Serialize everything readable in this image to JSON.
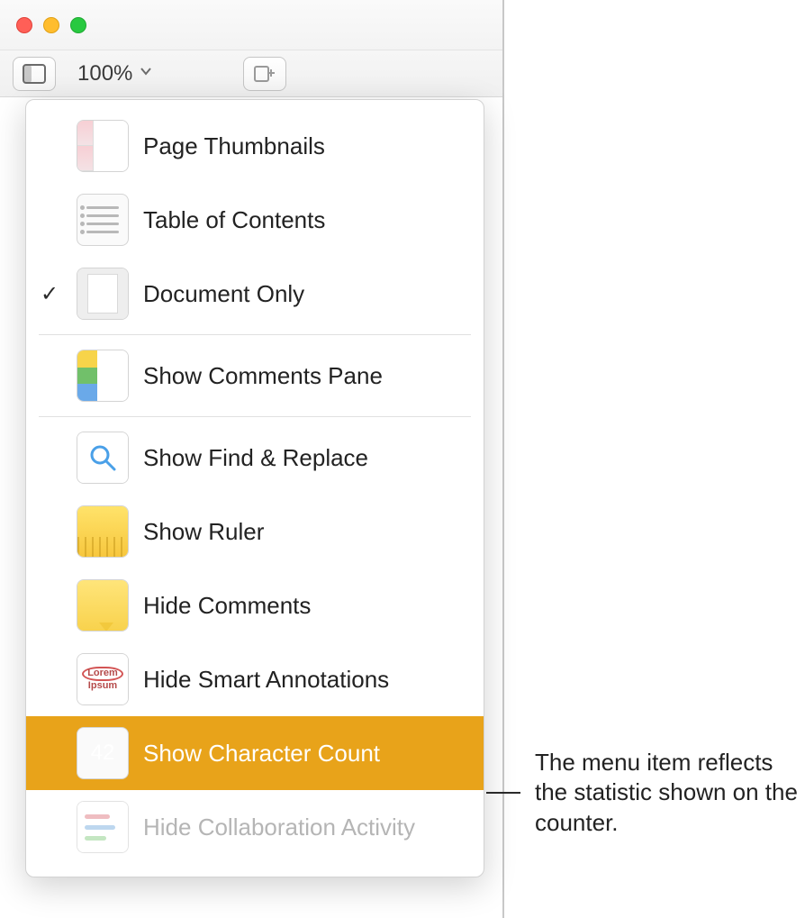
{
  "toolbar": {
    "zoom_label": "100%"
  },
  "menu": {
    "items": {
      "page_thumbnails": "Page Thumbnails",
      "table_of_contents": "Table of Contents",
      "document_only": "Document Only",
      "show_comments_pane": "Show Comments Pane",
      "show_find_replace": "Show Find & Replace",
      "show_ruler": "Show Ruler",
      "hide_comments": "Hide Comments",
      "hide_smart_annotations": "Hide Smart Annotations",
      "show_character_count": "Show Character Count",
      "hide_collaboration_activity": "Hide Collaboration Activity"
    },
    "count_badge": "42",
    "smart_annotation_sample_top": "Lorem",
    "smart_annotation_sample_bottom": "Ipsum"
  },
  "callout": "The menu item reflects the statistic shown on the counter."
}
